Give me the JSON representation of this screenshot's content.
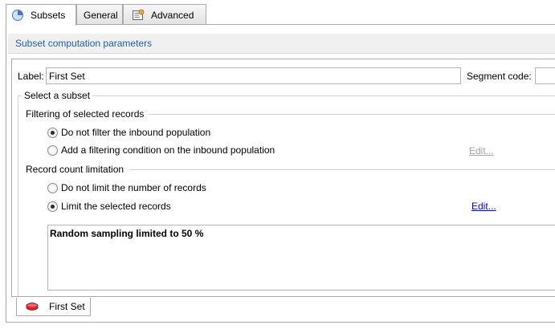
{
  "tabs": [
    {
      "label": "Subsets",
      "icon": "pie-chart-icon",
      "active": true
    },
    {
      "label": "General",
      "icon": "",
      "active": false
    },
    {
      "label": "Advanced",
      "icon": "settings-document-icon",
      "active": false
    }
  ],
  "section": {
    "title": "Subset computation parameters"
  },
  "form": {
    "label_caption": "Label:",
    "label_value": "First Set",
    "segment_caption": "Segment code:",
    "segment_value": ""
  },
  "subset": {
    "title": "Select a subset",
    "filtering": {
      "title": "Filtering of selected records",
      "option_no_filter": "Do not filter the inbound population",
      "option_add_filter": "Add a filtering condition on the inbound population",
      "selected": "no_filter",
      "edit_label": "Edit..."
    },
    "limitation": {
      "title": "Record count limitation",
      "option_no_limit": "Do not limit the number of records",
      "option_limit": "Limit the selected records",
      "selected": "limit",
      "edit_label": "Edit..."
    },
    "summary": "Random sampling limited to 50 %"
  },
  "bottom_tab": {
    "label": "First Set",
    "icon": "subset-icon"
  },
  "colors": {
    "section_title": "#1f5fa8",
    "link": "#0000cc",
    "subset_icon": "#d9262c"
  }
}
